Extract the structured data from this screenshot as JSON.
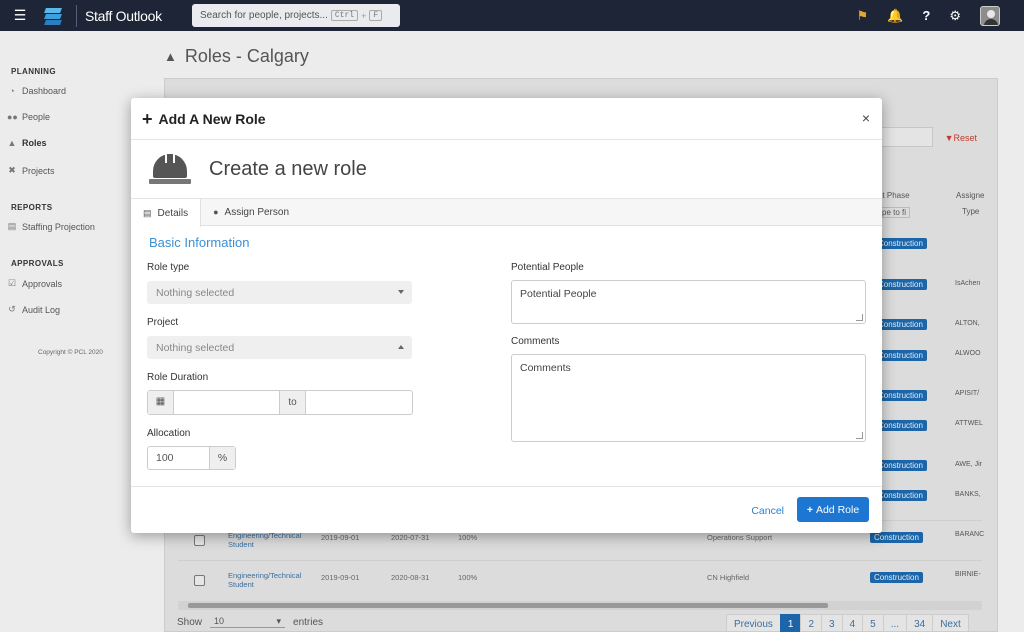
{
  "app": {
    "brand": "Staff Outlook",
    "hamburger": "☰"
  },
  "search": {
    "placeholder": "Search for people, projects...",
    "key1": "Ctrl",
    "plus": "+",
    "key2": "F"
  },
  "topbar_icons": [
    "tag-icon",
    "bell-icon",
    "help-icon",
    "gear-icon",
    "avatar"
  ],
  "sidebar": {
    "sections": [
      {
        "heading": "PLANNING",
        "items": [
          {
            "label": "Dashboard",
            "icon": "dashboard-icon"
          },
          {
            "label": "People",
            "icon": "people-icon"
          },
          {
            "label": "Roles",
            "icon": "hardhat-icon",
            "active": true
          },
          {
            "label": "Projects",
            "icon": "tools-icon"
          }
        ]
      },
      {
        "heading": "REPORTS",
        "items": [
          {
            "label": "Staffing Projection",
            "icon": "chart-icon"
          }
        ]
      },
      {
        "heading": "APPROVALS",
        "items": [
          {
            "label": "Approvals",
            "icon": "check-icon"
          },
          {
            "label": "Audit Log",
            "icon": "history-icon"
          }
        ]
      }
    ],
    "copyright": "Copyright © PCL 2020"
  },
  "page": {
    "title": "Roles - Calgary"
  },
  "background_table": {
    "reset": "Reset",
    "col_phase": "ect Phase",
    "col_phase_filter": "ype to fi",
    "col_assign": "Assigne",
    "col_assign_sub": "Type",
    "badge": "Construction",
    "right_names": [
      "IsAchen",
      "ALTON,",
      "ALWOO",
      "APISIT/",
      "ATTWEL",
      "AWE, Jir",
      "BANKS,",
      "BARANC",
      "BIRNIE-"
    ],
    "rows": [
      {
        "role": "Engineering/Technical Student",
        "start": "2019-09-01",
        "end": "2020-07-31",
        "alloc": "100%",
        "project": "Operations Support"
      },
      {
        "role": "Engineering/Technical Student",
        "start": "2019-09-01",
        "end": "2020-08-31",
        "alloc": "100%",
        "project": "CN Highfield"
      }
    ],
    "show_label": "Show",
    "show_value": "10",
    "entries_label": "entries",
    "pager": [
      "Previous",
      "1",
      "2",
      "3",
      "4",
      "5",
      "...",
      "34",
      "Next"
    ]
  },
  "modal": {
    "title": "Add A New Role",
    "close": "×",
    "hero_title": "Create a new role",
    "tabs": [
      {
        "label": "Details",
        "icon": "id-card-icon"
      },
      {
        "label": "Assign Person",
        "icon": "user-icon"
      }
    ],
    "section_title": "Basic Information",
    "role_type": {
      "label": "Role type",
      "value": "Nothing selected"
    },
    "project": {
      "label": "Project",
      "value": "Nothing selected"
    },
    "duration": {
      "label": "Role Duration",
      "to": "to"
    },
    "allocation": {
      "label": "Allocation",
      "value": "100",
      "unit": "%"
    },
    "potential": {
      "label": "Potential People",
      "placeholder": "Potential People"
    },
    "comments": {
      "label": "Comments",
      "placeholder": "Comments"
    },
    "cancel": "Cancel",
    "add": "Add Role"
  }
}
